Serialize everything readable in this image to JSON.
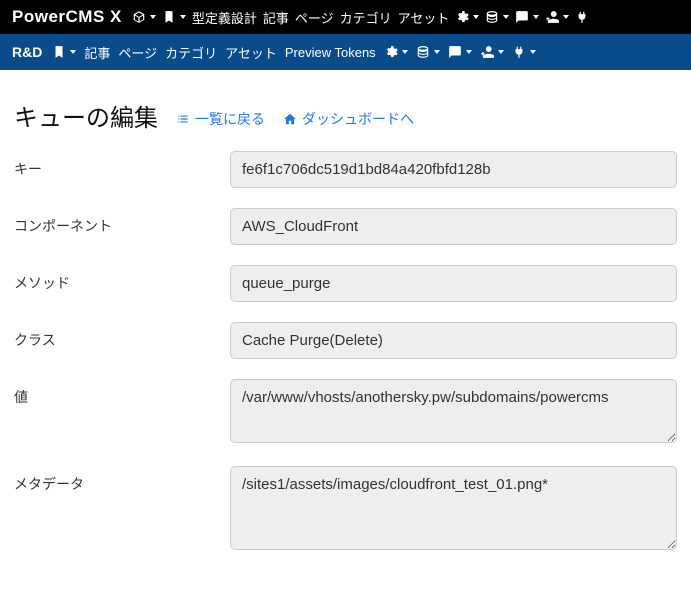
{
  "topnav": {
    "brand": "PowerCMS X",
    "items": [
      {
        "label": "型定義設計"
      },
      {
        "label": "記事"
      },
      {
        "label": "ページ"
      },
      {
        "label": "カテゴリ"
      },
      {
        "label": "アセット"
      }
    ]
  },
  "subnav": {
    "scope": "R&D",
    "items": [
      {
        "label": "記事"
      },
      {
        "label": "ページ"
      },
      {
        "label": "カテゴリ"
      },
      {
        "label": "アセット"
      },
      {
        "label": "Preview Tokens"
      }
    ]
  },
  "header": {
    "title": "キューの編集",
    "back_link": "一覧に戻る",
    "dashboard_link": "ダッシュボードへ"
  },
  "form": {
    "rows": [
      {
        "label": "キー",
        "value": "fe6f1c706dc519d1bd84a420fbfd128b",
        "type": "text"
      },
      {
        "label": "コンポーネント",
        "value": "AWS_CloudFront",
        "type": "text"
      },
      {
        "label": "メソッド",
        "value": "queue_purge",
        "type": "text"
      },
      {
        "label": "クラス",
        "value": "Cache Purge(Delete)",
        "type": "text"
      },
      {
        "label": "値",
        "value": "/var/www/vhosts/anothersky.pw/subdomains/powercms",
        "type": "textarea"
      },
      {
        "label": "メタデータ",
        "value": "/sites1/assets/images/cloudfront_test_01.png*",
        "type": "textarea"
      }
    ]
  }
}
